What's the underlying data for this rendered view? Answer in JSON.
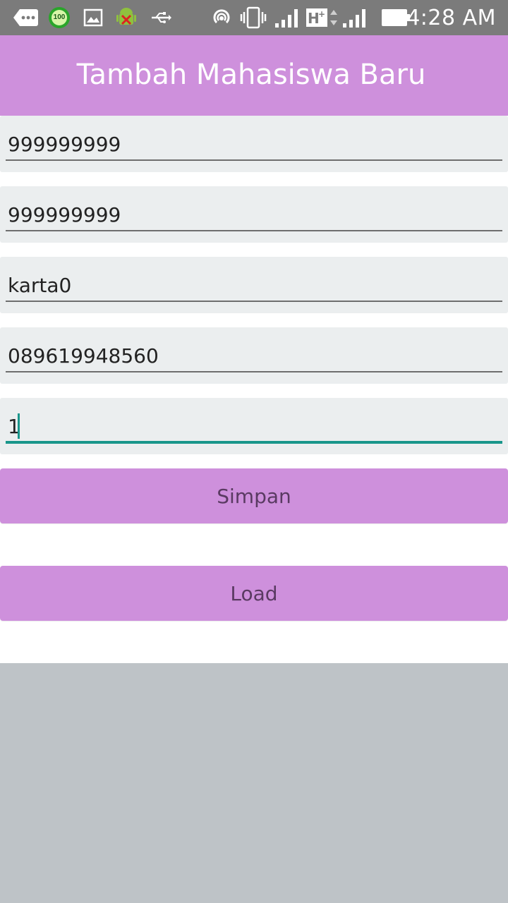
{
  "status_bar": {
    "time": "4:28 AM",
    "battery_badge": "100",
    "network_type": "H+",
    "icons": [
      "more-icon",
      "battery-100-icon",
      "image-icon",
      "android-debug-icon",
      "usb-icon",
      "hotspot-icon",
      "vibrate-icon",
      "signal-icon",
      "h-plus-icon",
      "signal-icon-2",
      "battery-icon"
    ]
  },
  "app_bar": {
    "title": "Tambah Mahasiswa Baru"
  },
  "form": {
    "fields": [
      {
        "value": "999999999"
      },
      {
        "value": "999999999"
      },
      {
        "value": "karta0"
      },
      {
        "value": "089619948560"
      },
      {
        "value": "1"
      }
    ],
    "save_label": "Simpan",
    "load_label": "Load"
  },
  "colors": {
    "accent": "#ce90dc",
    "focus": "#19968b",
    "status_bar": "#7b7b7b",
    "field_bg": "#ebeeef"
  }
}
